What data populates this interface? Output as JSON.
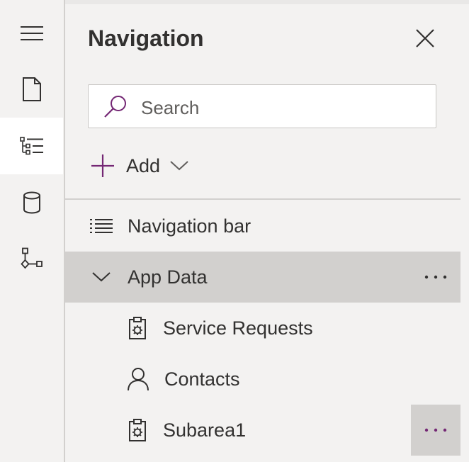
{
  "panel": {
    "title": "Navigation",
    "search_placeholder": "Search",
    "add_label": "Add"
  },
  "rail": {
    "icons": [
      "hamburger-icon",
      "page-icon",
      "tree-view-icon",
      "database-icon",
      "process-flow-icon"
    ],
    "active_index": 2
  },
  "tree": {
    "nav_bar": {
      "label": "Navigation bar",
      "icon": "list-icon"
    },
    "group": {
      "label": "App Data",
      "expanded": true,
      "selected": true
    },
    "items": [
      {
        "label": "Service Requests",
        "icon": "clipboard-gear-icon"
      },
      {
        "label": "Contacts",
        "icon": "person-icon"
      },
      {
        "label": "Subarea1",
        "icon": "clipboard-gear-icon"
      }
    ]
  },
  "colors": {
    "accent": "#742774",
    "selected_bg": "#d2d0ce",
    "panel_bg": "#f3f2f1",
    "active_rail_bg": "#ffffff"
  }
}
